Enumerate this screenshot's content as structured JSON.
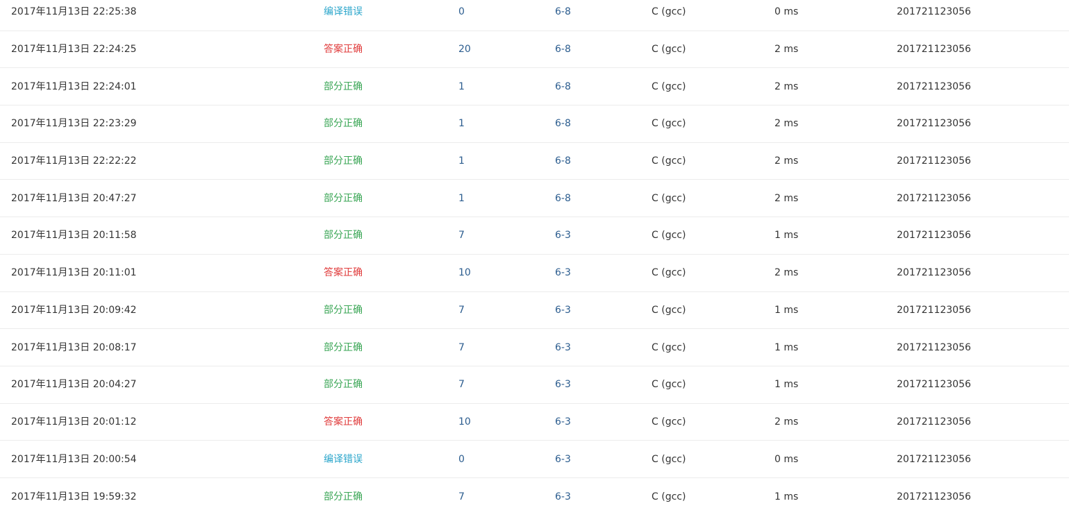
{
  "status_colors": {
    "编译错误": "#2ba6cb",
    "答案正确": "#e03b3b",
    "部分正确": "#3aa655"
  },
  "link_color": "#2c5d8f",
  "rows": [
    {
      "time": "2017年11月13日 22:25:38",
      "status": "编译错误",
      "score": "0",
      "problem": "6-8",
      "lang": "C (gcc)",
      "duration": "0 ms",
      "user": "201721123056"
    },
    {
      "time": "2017年11月13日 22:24:25",
      "status": "答案正确",
      "score": "20",
      "problem": "6-8",
      "lang": "C (gcc)",
      "duration": "2 ms",
      "user": "201721123056"
    },
    {
      "time": "2017年11月13日 22:24:01",
      "status": "部分正确",
      "score": "1",
      "problem": "6-8",
      "lang": "C (gcc)",
      "duration": "2 ms",
      "user": "201721123056"
    },
    {
      "time": "2017年11月13日 22:23:29",
      "status": "部分正确",
      "score": "1",
      "problem": "6-8",
      "lang": "C (gcc)",
      "duration": "2 ms",
      "user": "201721123056"
    },
    {
      "time": "2017年11月13日 22:22:22",
      "status": "部分正确",
      "score": "1",
      "problem": "6-8",
      "lang": "C (gcc)",
      "duration": "2 ms",
      "user": "201721123056"
    },
    {
      "time": "2017年11月13日 20:47:27",
      "status": "部分正确",
      "score": "1",
      "problem": "6-8",
      "lang": "C (gcc)",
      "duration": "2 ms",
      "user": "201721123056"
    },
    {
      "time": "2017年11月13日 20:11:58",
      "status": "部分正确",
      "score": "7",
      "problem": "6-3",
      "lang": "C (gcc)",
      "duration": "1 ms",
      "user": "201721123056"
    },
    {
      "time": "2017年11月13日 20:11:01",
      "status": "答案正确",
      "score": "10",
      "problem": "6-3",
      "lang": "C (gcc)",
      "duration": "2 ms",
      "user": "201721123056"
    },
    {
      "time": "2017年11月13日 20:09:42",
      "status": "部分正确",
      "score": "7",
      "problem": "6-3",
      "lang": "C (gcc)",
      "duration": "1 ms",
      "user": "201721123056"
    },
    {
      "time": "2017年11月13日 20:08:17",
      "status": "部分正确",
      "score": "7",
      "problem": "6-3",
      "lang": "C (gcc)",
      "duration": "1 ms",
      "user": "201721123056"
    },
    {
      "time": "2017年11月13日 20:04:27",
      "status": "部分正确",
      "score": "7",
      "problem": "6-3",
      "lang": "C (gcc)",
      "duration": "1 ms",
      "user": "201721123056"
    },
    {
      "time": "2017年11月13日 20:01:12",
      "status": "答案正确",
      "score": "10",
      "problem": "6-3",
      "lang": "C (gcc)",
      "duration": "2 ms",
      "user": "201721123056"
    },
    {
      "time": "2017年11月13日 20:00:54",
      "status": "编译错误",
      "score": "0",
      "problem": "6-3",
      "lang": "C (gcc)",
      "duration": "0 ms",
      "user": "201721123056"
    },
    {
      "time": "2017年11月13日 19:59:32",
      "status": "部分正确",
      "score": "7",
      "problem": "6-3",
      "lang": "C (gcc)",
      "duration": "1 ms",
      "user": "201721123056"
    }
  ]
}
